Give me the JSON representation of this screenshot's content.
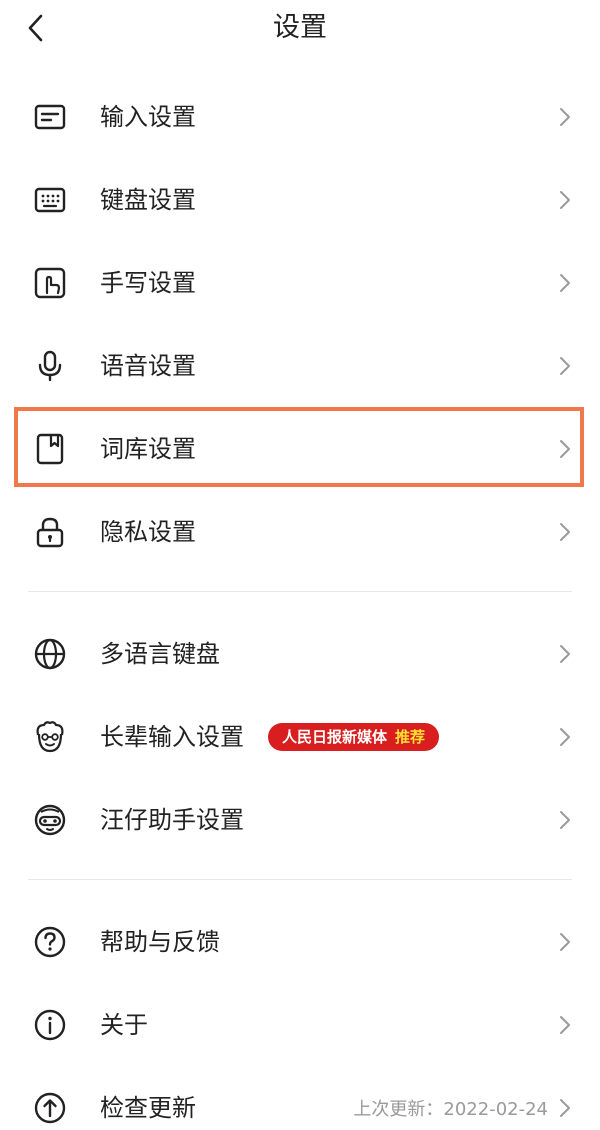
{
  "header": {
    "title": "设置"
  },
  "section1": [
    {
      "label": "输入设置",
      "icon": "input-settings-icon"
    },
    {
      "label": "键盘设置",
      "icon": "keyboard-icon"
    },
    {
      "label": "手写设置",
      "icon": "handwriting-icon"
    },
    {
      "label": "语音设置",
      "icon": "microphone-icon"
    },
    {
      "label": "词库设置",
      "icon": "dictionary-icon",
      "highlighted": true
    },
    {
      "label": "隐私设置",
      "icon": "lock-icon"
    }
  ],
  "section2": [
    {
      "label": "多语言键盘",
      "icon": "globe-icon"
    },
    {
      "label": "长辈输入设置",
      "icon": "elder-face-icon",
      "badge": {
        "text": "人民日报新媒体",
        "highlight": "推荐"
      }
    },
    {
      "label": "汪仔助手设置",
      "icon": "mascot-icon"
    }
  ],
  "section3": [
    {
      "label": "帮助与反馈",
      "icon": "help-icon"
    },
    {
      "label": "关于",
      "icon": "info-icon"
    },
    {
      "label": "检查更新",
      "icon": "update-icon",
      "meta": "上次更新：2022-02-24"
    }
  ],
  "colors": {
    "highlight_border": "#f0784a",
    "badge_bg": "#d81e1e",
    "badge_highlight": "#ffdd33"
  }
}
